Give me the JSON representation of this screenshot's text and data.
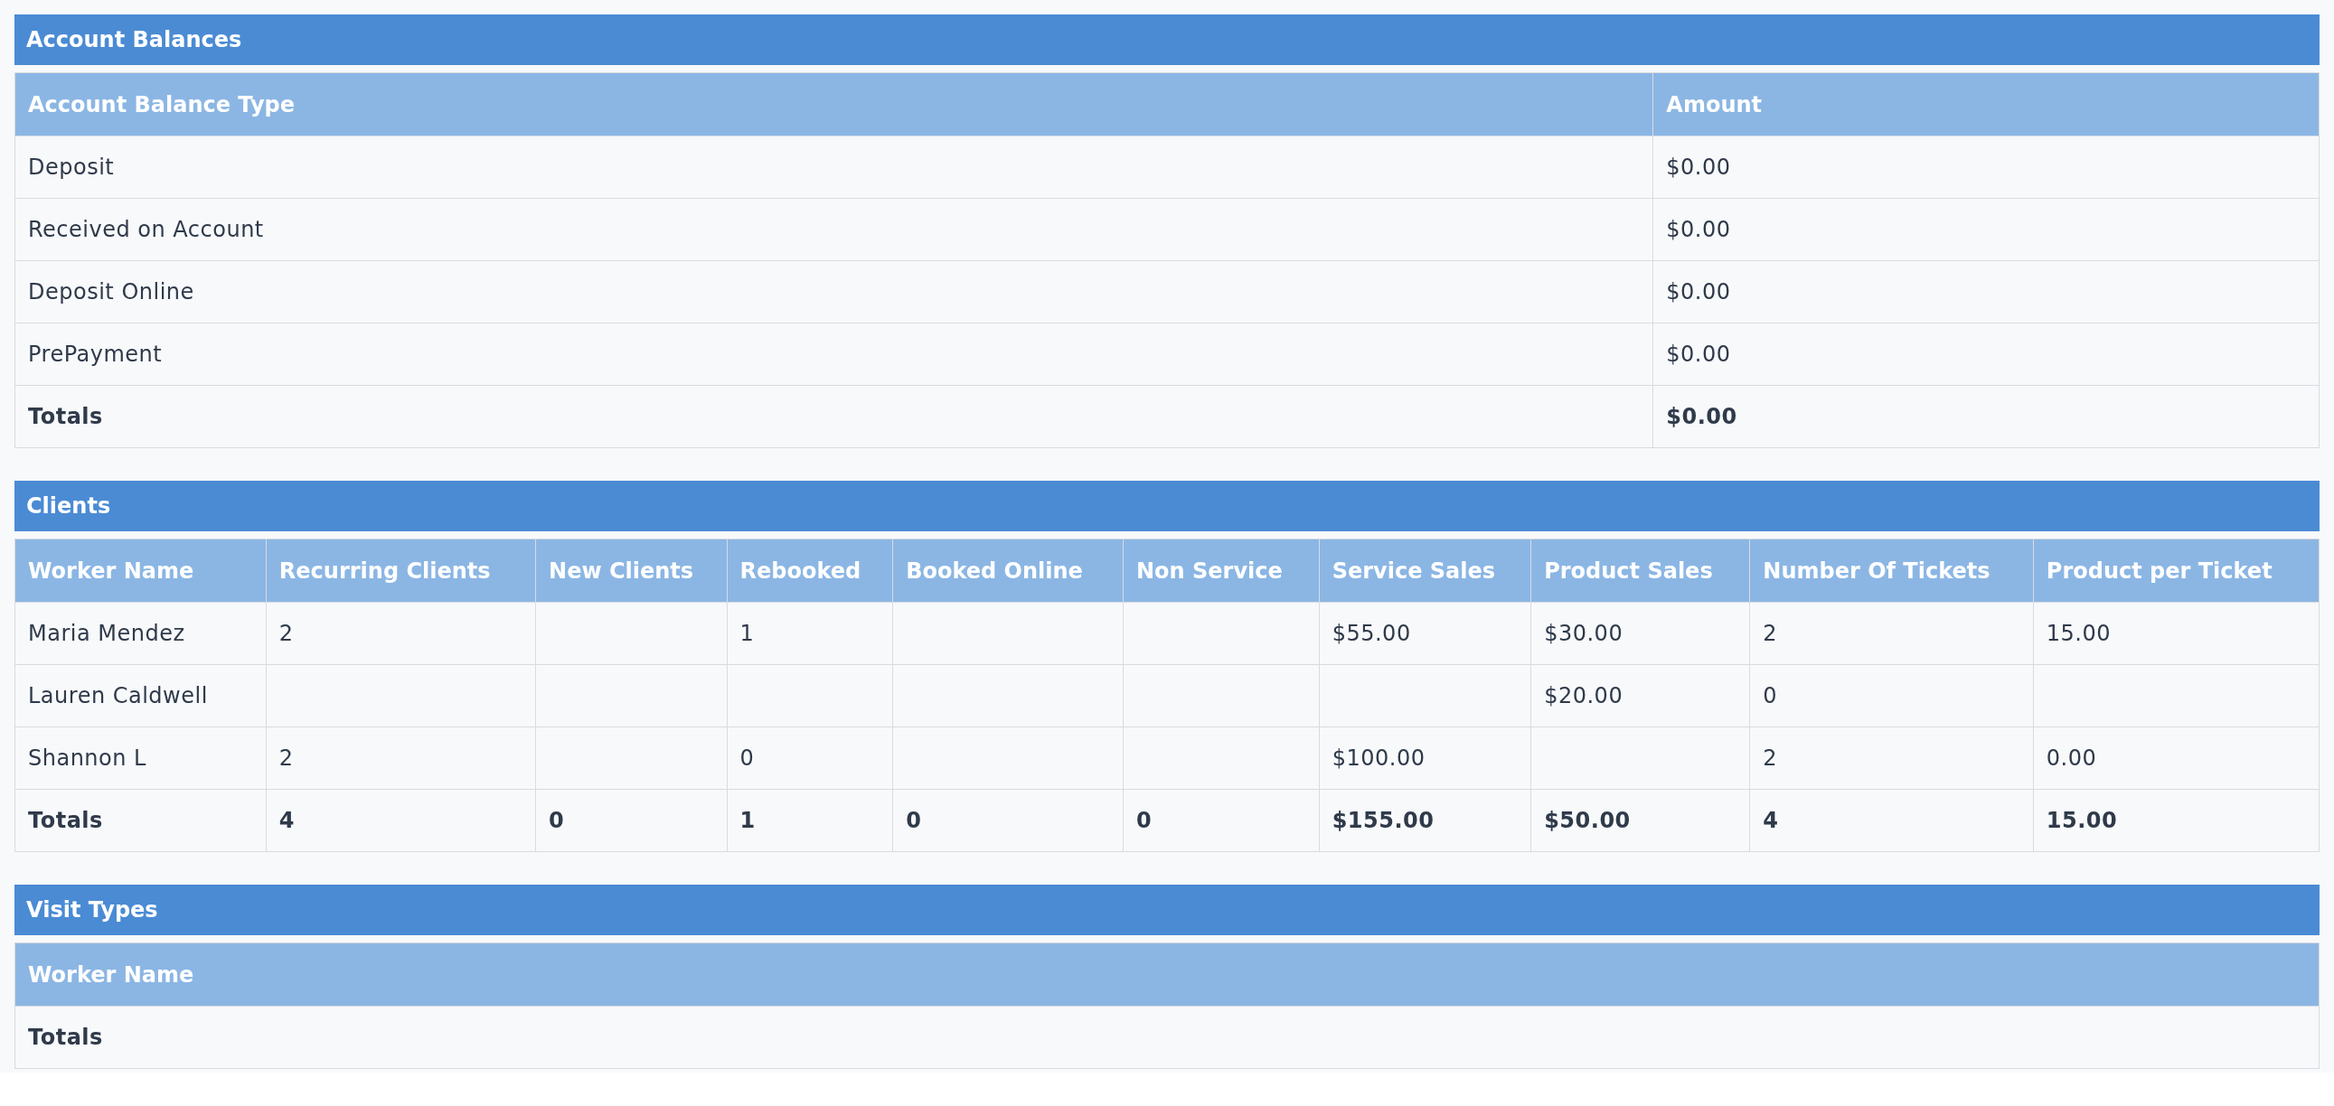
{
  "sections": [
    {
      "title": "Account Balances",
      "columns": [
        "Account Balance Type",
        "Amount"
      ],
      "rows": [
        {
          "kind": "data",
          "cells": [
            "Deposit",
            "$0.00"
          ]
        },
        {
          "kind": "data",
          "cells": [
            "Received on Account",
            "$0.00"
          ]
        },
        {
          "kind": "data",
          "cells": [
            "Deposit Online",
            "$0.00"
          ]
        },
        {
          "kind": "data",
          "cells": [
            "PrePayment",
            "$0.00"
          ]
        },
        {
          "kind": "totals",
          "cells": [
            "Totals",
            "$0.00"
          ]
        }
      ]
    },
    {
      "title": "Clients",
      "columns": [
        "Worker Name",
        "Recurring Clients",
        "New Clients",
        "Rebooked",
        "Booked Online",
        "Non Service",
        "Service Sales",
        "Product Sales",
        "Number Of Tickets",
        "Product per Ticket"
      ],
      "rows": [
        {
          "kind": "data",
          "cells": [
            "Maria Mendez",
            "2",
            null,
            "1",
            null,
            null,
            "$55.00",
            "$30.00",
            "2",
            "15.00"
          ]
        },
        {
          "kind": "data",
          "cells": [
            "Lauren Caldwell",
            null,
            null,
            null,
            null,
            null,
            null,
            "$20.00",
            "0",
            null
          ]
        },
        {
          "kind": "data",
          "cells": [
            "Shannon L",
            "2",
            null,
            "0",
            null,
            null,
            "$100.00",
            null,
            "2",
            "0.00"
          ]
        },
        {
          "kind": "totals",
          "cells": [
            "Totals",
            "4",
            "0",
            "1",
            "0",
            "0",
            "$155.00",
            "$50.00",
            "4",
            "15.00"
          ]
        }
      ]
    },
    {
      "title": "Visit Types",
      "columns": [
        "Worker Name"
      ],
      "rows": [
        {
          "kind": "totals",
          "cells": [
            "Totals"
          ]
        }
      ]
    }
  ]
}
